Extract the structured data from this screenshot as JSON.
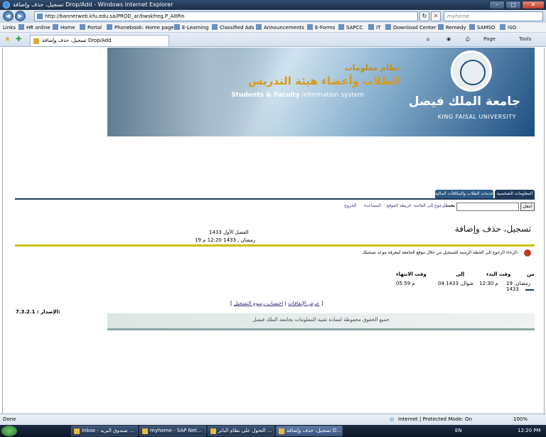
{
  "window": {
    "title": "تسجيل، حذف وإضافة Drop/Add - Windows Internet Explorer"
  },
  "browser": {
    "url": "http://bannerweb.kfu.edu.sa/PROD_ar/bwskfreg.P_AltPin",
    "search_placeholder": "myhome",
    "links": [
      "Links",
      "HR online",
      "Home",
      "Portal",
      "Phonebook: Home page",
      "E-Learning",
      "Classified Ads",
      "Announcements",
      "E-Forms",
      "SAPCC",
      "IT",
      "Download Center",
      "Remedy",
      "SAMSO",
      "ISO"
    ],
    "tab_title": "تسجيل، حذف وإضافة Drop/Add",
    "commands": {
      "page": "Page",
      "tools": "Tools"
    }
  },
  "banner": {
    "title_line1": "نظام معلومات",
    "title_line2": "الطلاب وأعضاء هيئة التدريس",
    "subtitle_bold": "Students & Faculty",
    "subtitle_rest": " information system",
    "university_ar": "جامعة الملك فيصل",
    "university_en": "KING FAISAL UNIVERSITY"
  },
  "menu_tabs": [
    "المعلومات الشخصية",
    "خدمات الطلاب والمكافآت المالية"
  ],
  "search": {
    "button": "انتقل",
    "label": "بحث"
  },
  "top_links": [
    "الرجوع إلى القائمة",
    "خريطة الموقع",
    "المساعدة",
    "الخروج"
  ],
  "page": {
    "title": "تسجيل، حذف وإضافة",
    "term": "الفصل الأول 1433",
    "datetime": "19 رمضان , 1433 12:20 م",
    "warning": "الرجاء الرجوع الى الخطة الزمنية للتسجيل من خلال موقع الجامعة لمعرفة موعد تسجيلك.",
    "table_headers": [
      "من",
      "وقت البدء",
      "إلى",
      "وقت الانتهاء"
    ],
    "table_row": [
      "19 رمضان, 1433",
      "12:30 م",
      "04 شوال, 1433",
      "05:59 م"
    ],
    "bottom_links": [
      "عرض الإيقافات",
      "احتساب رسوم التسجيل"
    ],
    "release_label": "الإصدار:",
    "release_value": "7.3.2.1",
    "footer": "جميع الحقوق محفوظة لعمادة تقنية المعلومات بجامعة الملك فيصل"
  },
  "status": {
    "left": "Done",
    "zone": "Internet | Protected Mode: On",
    "zoom": "100%"
  },
  "taskbar": {
    "items": [
      "Inbox - صندوق البريد ...",
      "myhome - SAP Net...",
      "التحول على نظام البانر ...",
      "تسجيل، حذف وإضافة D..."
    ],
    "lang": "EN",
    "clock": "12:20 PM"
  }
}
